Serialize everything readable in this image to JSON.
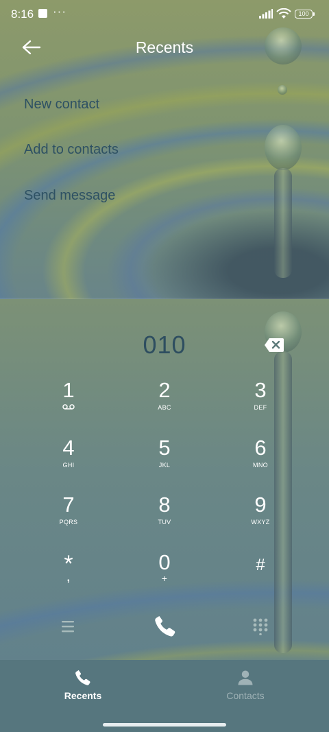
{
  "status_bar": {
    "time": "8:16",
    "notification_dots": "···",
    "battery_level": "100"
  },
  "header": {
    "title": "Recents",
    "back_icon": "arrow-left-icon"
  },
  "menu": {
    "items": [
      {
        "label": "New contact"
      },
      {
        "label": "Add to contacts"
      },
      {
        "label": "Send message"
      }
    ]
  },
  "dialer": {
    "number": "010",
    "backspace_icon": "backspace-icon",
    "keys": [
      {
        "digit": "1",
        "letters": "voicemail-icon"
      },
      {
        "digit": "2",
        "letters": "ABC"
      },
      {
        "digit": "3",
        "letters": "DEF"
      },
      {
        "digit": "4",
        "letters": "GHI"
      },
      {
        "digit": "5",
        "letters": "JKL"
      },
      {
        "digit": "6",
        "letters": "MNO"
      },
      {
        "digit": "7",
        "letters": "PQRS"
      },
      {
        "digit": "8",
        "letters": "TUV"
      },
      {
        "digit": "9",
        "letters": "WXYZ"
      },
      {
        "digit": "*",
        "letters": ","
      },
      {
        "digit": "0",
        "letters": "+"
      },
      {
        "digit": "#",
        "letters": ""
      }
    ],
    "controls": {
      "menu_icon": "menu-icon",
      "call_icon": "phone-icon",
      "dialpad_icon": "dialpad-icon"
    }
  },
  "bottom_nav": {
    "tabs": [
      {
        "label": "Recents",
        "icon": "phone-icon",
        "active": true
      },
      {
        "label": "Contacts",
        "icon": "person-icon",
        "active": false
      }
    ]
  },
  "colors": {
    "menu_text": "#2e5163",
    "number_text": "#2e4e60",
    "nav_background": "#56767e",
    "inactive_tab": "#9fb2b6"
  }
}
